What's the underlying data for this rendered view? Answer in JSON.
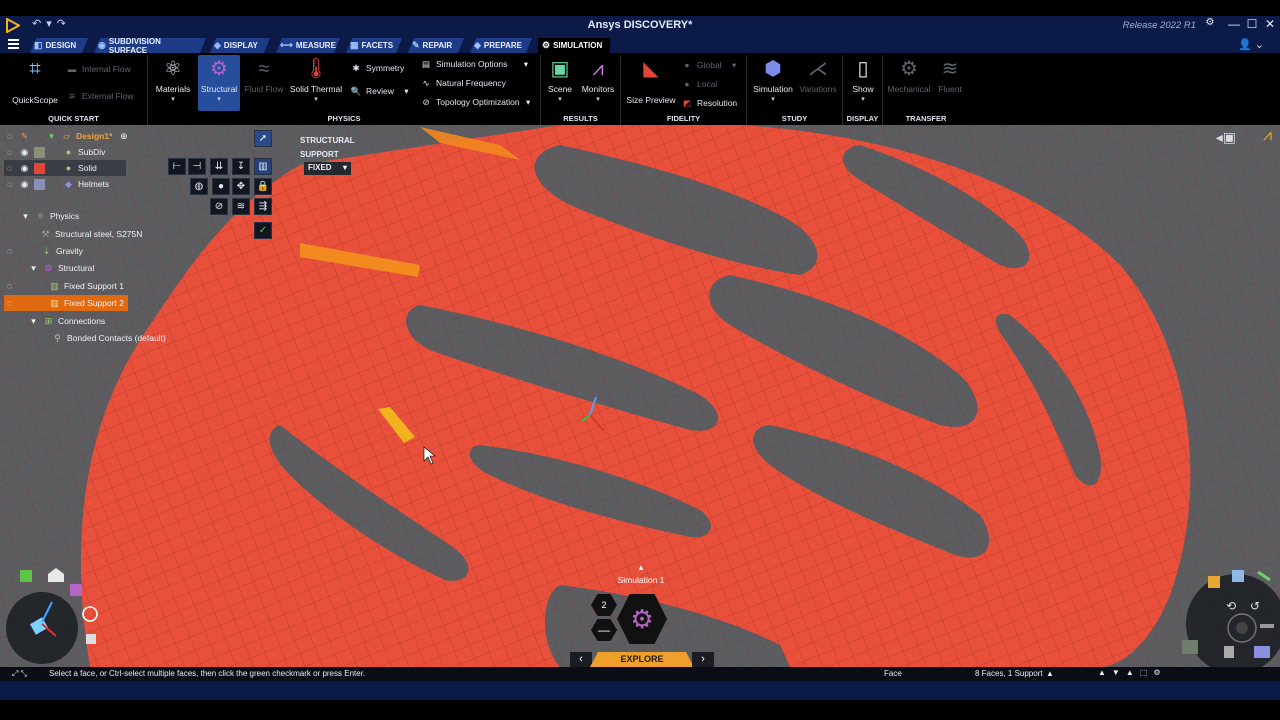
{
  "window": {
    "title": "Ansys DISCOVERY*",
    "release": "Release 2022 R1",
    "controls": [
      "—",
      "☐",
      "✕"
    ]
  },
  "tabs": [
    {
      "label": "Design",
      "icon": "design-icon"
    },
    {
      "label": "Subdivision Surface",
      "icon": "subdivision-icon"
    },
    {
      "label": "Display",
      "icon": "display-icon"
    },
    {
      "label": "Measure",
      "icon": "measure-icon"
    },
    {
      "label": "Facets",
      "icon": "facets-icon"
    },
    {
      "label": "Repair",
      "icon": "repair-icon"
    },
    {
      "label": "Prepare",
      "icon": "prepare-icon"
    },
    {
      "label": "Simulation",
      "icon": "simulation-icon"
    }
  ],
  "ribbon": {
    "quickstart": {
      "label": "Quick Start",
      "quickscope": "QuickScope",
      "internal_flow": "Internal Flow",
      "external_flow": "External Flow"
    },
    "physics": {
      "label": "Physics",
      "materials": "Materials",
      "structural": "Structural",
      "fluid_flow": "Fluid Flow",
      "solid_thermal": "Solid Thermal",
      "symmetry": "Symmetry",
      "review": "Review",
      "simulation_options": "Simulation Options",
      "natural_frequency": "Natural Frequency",
      "topology_optimization": "Topology Optimization"
    },
    "results": {
      "label": "Results",
      "scene": "Scene",
      "monitors": "Monitors"
    },
    "fidelity": {
      "label": "Fidelity",
      "size_preview": "Size Preview",
      "global": "Global",
      "local": "Local",
      "resolution": "Resolution"
    },
    "study": {
      "label": "Study",
      "simulation": "Simulation",
      "variations": "Variations"
    },
    "display": {
      "label": "Display",
      "show": "Show"
    },
    "transfer": {
      "label": "Transfer",
      "mechanical": "Mechanical",
      "fluent": "Fluent"
    }
  },
  "tree": {
    "design": "Design1*",
    "subdiv": "SubDiv",
    "solid": "Solid",
    "helmets": "Helmets",
    "physics": "Physics",
    "material": "Structural steel, S275N",
    "gravity": "Gravity",
    "structural": "Structural",
    "fixed_support_1": "Fixed Support 1",
    "fixed_support_2": "Fixed Support 2",
    "connections": "Connections",
    "bonded_contacts": "Bonded Contacts (default)"
  },
  "tooltip": {
    "line1": "Structural",
    "line2": "Support",
    "fixed": "Fixed"
  },
  "bottom": {
    "simulation_label": "Simulation 1",
    "explore": "Explore",
    "hex_count": "2",
    "status_text": "Select a face, or Ctrl-select multiple faces, then click the green checkmark or press Enter.",
    "selection_type": "Face",
    "selection_summary": "8 Faces, 1 Support"
  },
  "colors": {
    "accent": "#e06a12",
    "model": "#e8503b",
    "title_bar": "#0b1a46",
    "explore": "#f0a02a"
  }
}
